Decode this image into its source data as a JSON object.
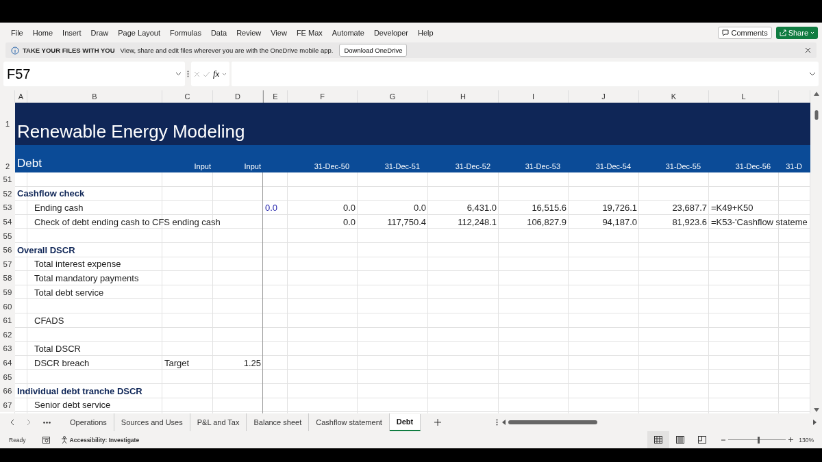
{
  "menu": [
    "File",
    "Home",
    "Insert",
    "Draw",
    "Page Layout",
    "Formulas",
    "Data",
    "Review",
    "View",
    "FE Max",
    "Automate",
    "Developer",
    "Help"
  ],
  "actions": {
    "comments": "Comments",
    "share": "Share"
  },
  "info_bar": {
    "title": "TAKE YOUR FILES WITH YOU",
    "message": "View, share and edit files wherever you are with the OneDrive mobile app.",
    "button": "Download OneDrive"
  },
  "formula_bar": {
    "name_box": "F57",
    "function_label": "fx"
  },
  "columns": [
    "A",
    "B",
    "C",
    "D",
    "E",
    "F",
    "G",
    "H",
    "I",
    "J",
    "K",
    "L"
  ],
  "rows": [
    {
      "number": "1",
      "kind": "title",
      "label": "Renewable Energy Modeling"
    },
    {
      "number": "2",
      "kind": "header",
      "label": "Debt",
      "cells": {
        "C": {
          "text": "Input"
        },
        "D": {
          "text": "Input"
        },
        "F": {
          "text": "31-Dec-50"
        },
        "G": {
          "text": "31-Dec-51"
        },
        "H": {
          "text": "31-Dec-52"
        },
        "I": {
          "text": "31-Dec-53"
        },
        "J": {
          "text": "31-Dec-54"
        },
        "K": {
          "text": "31-Dec-55"
        },
        "L": {
          "text": "31-Dec-56"
        },
        "M": {
          "text": "31-D"
        }
      }
    },
    {
      "number": "51",
      "kind": "blank"
    },
    {
      "number": "52",
      "kind": "section",
      "label": "Cashflow check"
    },
    {
      "number": "53",
      "kind": "item",
      "label": "Ending cash",
      "cells": {
        "E": {
          "text": "0.0",
          "kind": "input"
        },
        "F": {
          "text": "0.0",
          "kind": "number"
        },
        "G": {
          "text": "0.0",
          "kind": "number"
        },
        "H": {
          "text": "6,431.0",
          "kind": "number"
        },
        "I": {
          "text": "16,515.6",
          "kind": "number"
        },
        "J": {
          "text": "19,726.1",
          "kind": "number"
        },
        "K": {
          "text": "23,687.7",
          "kind": "number"
        },
        "L": {
          "text": "=K49+K50",
          "kind": "formula"
        }
      }
    },
    {
      "number": "54",
      "kind": "item",
      "label": "Check of debt ending cash to CFS ending cash",
      "cells": {
        "F": {
          "text": "0.0",
          "kind": "number"
        },
        "G": {
          "text": "117,750.4",
          "kind": "number"
        },
        "H": {
          "text": "112,248.1",
          "kind": "number"
        },
        "I": {
          "text": "106,827.9",
          "kind": "number"
        },
        "J": {
          "text": "94,187.0",
          "kind": "number"
        },
        "K": {
          "text": "81,923.6",
          "kind": "number"
        },
        "L": {
          "text": "=K53-'Cashflow stateme",
          "kind": "formula"
        }
      }
    },
    {
      "number": "55",
      "kind": "blank"
    },
    {
      "number": "56",
      "kind": "section",
      "label": "Overall DSCR"
    },
    {
      "number": "57",
      "kind": "item",
      "label": "Total interest expense"
    },
    {
      "number": "58",
      "kind": "item",
      "label": "Total mandatory payments"
    },
    {
      "number": "59",
      "kind": "item",
      "label": "Total debt service"
    },
    {
      "number": "60",
      "kind": "blank"
    },
    {
      "number": "61",
      "kind": "item",
      "label": "CFADS"
    },
    {
      "number": "62",
      "kind": "blank"
    },
    {
      "number": "63",
      "kind": "item",
      "label": "Total DSCR"
    },
    {
      "number": "64",
      "kind": "item",
      "label": "DSCR breach",
      "cells": {
        "C": {
          "text": "Target",
          "kind": "text"
        },
        "D": {
          "text": "1.25",
          "kind": "number"
        }
      }
    },
    {
      "number": "65",
      "kind": "blank"
    },
    {
      "number": "66",
      "kind": "section",
      "label": "Individual debt tranche DSCR"
    },
    {
      "number": "67",
      "kind": "item",
      "label": "Senior debt service"
    }
  ],
  "sheet_tabs": [
    {
      "label": "Operations",
      "selected": false
    },
    {
      "label": "Sources and Uses",
      "selected": false
    },
    {
      "label": "P&L and Tax",
      "selected": false
    },
    {
      "label": "Balance sheet",
      "selected": false
    },
    {
      "label": "Cashflow statement",
      "selected": false
    },
    {
      "label": "Debt",
      "selected": true
    }
  ],
  "status_bar": {
    "state": "Ready",
    "accessibility": "Accessibility: Investigate",
    "views": [
      {
        "kind": "normal",
        "selected": true
      },
      {
        "kind": "page-layout",
        "selected": false
      },
      {
        "kind": "page-break",
        "selected": false
      }
    ],
    "zoom": {
      "level": 0.52,
      "reading": "130%"
    }
  }
}
